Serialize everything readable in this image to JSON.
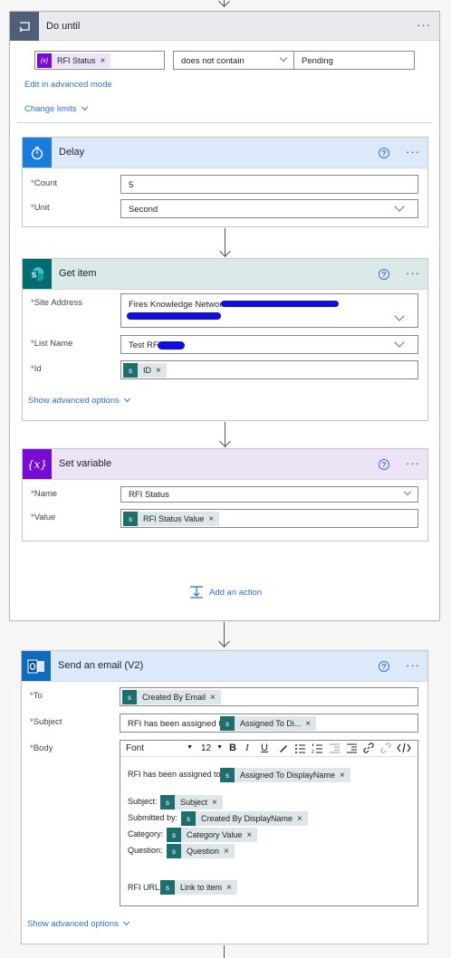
{
  "do_until": {
    "title": "Do until",
    "condition_token": "RFI Status",
    "operator": "does not contain",
    "value": "Pending",
    "edit_advanced": "Edit in advanced mode",
    "change_limits": "Change limits",
    "add_action": "Add an action"
  },
  "delay": {
    "title": "Delay",
    "count_label": "Count",
    "count_value": "5",
    "unit_label": "Unit",
    "unit_value": "Second"
  },
  "get_item": {
    "title": "Get item",
    "site_label": "Site Address",
    "site_value": "Fires Knowledge Network",
    "list_label": "List Name",
    "list_value": "Test RFI",
    "id_label": "Id",
    "id_token": "ID",
    "show_advanced": "Show advanced options"
  },
  "set_variable": {
    "title": "Set variable",
    "name_label": "Name",
    "name_value": "RFI Status",
    "value_label": "Value",
    "value_token": "RFI Status Value"
  },
  "send_email": {
    "title": "Send an email (V2)",
    "to_label": "To",
    "to_token": "Created By Email",
    "subject_label": "Subject",
    "subject_prefix": "RFI has been assigned to",
    "subject_token": "Assigned To Di...",
    "body_label": "Body",
    "toolbar_font": "Font",
    "toolbar_size": "12",
    "body": {
      "line1_text": "RFI has been assigned to",
      "line1_token": "Assigned To DisplayName",
      "subject_text": "Subject:",
      "subject_token": "Subject",
      "submitted_text": "Submitted by:",
      "submitted_token": "Created By DisplayName",
      "category_text": "Category:",
      "category_token": "Category Value",
      "question_text": "Question:",
      "question_token": "Question",
      "url_text": "RFI URL:",
      "url_token": "Link to item"
    },
    "show_advanced": "Show advanced options"
  },
  "icons": {
    "close": "×",
    "help": "?",
    "more": "···"
  },
  "colors": {
    "do_until_header": "#e8eaee",
    "do_until_icon": "#505f79",
    "delay_header": "#dbe9fa",
    "delay_icon": "#1b7ddb",
    "get_item_header": "#dbe9e9",
    "get_item_icon": "#036c70",
    "set_variable_header": "#ece3f7",
    "set_variable_icon": "#770bd6",
    "email_header": "#dbe9fa",
    "email_icon": "#0f6cbd",
    "link": "#2b6fd6",
    "required": "#d13438"
  }
}
